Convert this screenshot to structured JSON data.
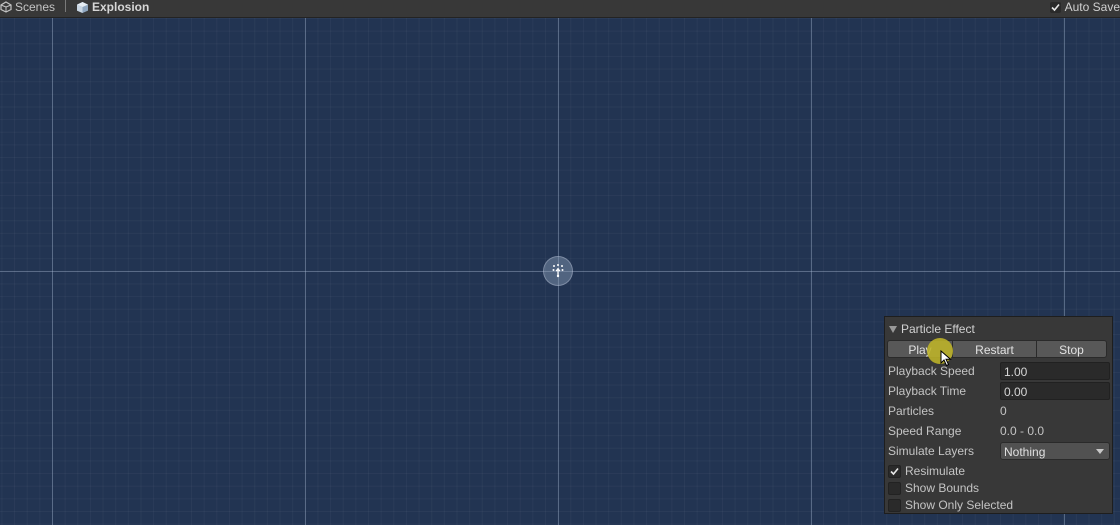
{
  "topbar": {
    "scenes_label": "Scenes",
    "prefab_label": "Explosion",
    "autosave_label": "Auto Save",
    "autosave_checked": true
  },
  "viewport": {
    "gizmo": "particle-system-gizmo"
  },
  "particle_panel": {
    "title": "Particle Effect",
    "buttons": {
      "play": "Play",
      "restart": "Restart",
      "stop": "Stop"
    },
    "playback_speed": {
      "label": "Playback Speed",
      "value": "1.00"
    },
    "playback_time": {
      "label": "Playback Time",
      "value": "0.00"
    },
    "particles": {
      "label": "Particles",
      "value": "0"
    },
    "speed_range": {
      "label": "Speed Range",
      "value": "0.0 - 0.0"
    },
    "simulate_layers": {
      "label": "Simulate Layers",
      "value": "Nothing"
    },
    "resimulate": {
      "label": "Resimulate",
      "checked": true
    },
    "show_bounds": {
      "label": "Show Bounds",
      "checked": false
    },
    "show_only_selected": {
      "label": "Show Only Selected",
      "checked": false
    }
  },
  "colors": {
    "scene_background": "#223452",
    "panel_background": "#383838",
    "cursor_highlight": "#bfb428"
  }
}
